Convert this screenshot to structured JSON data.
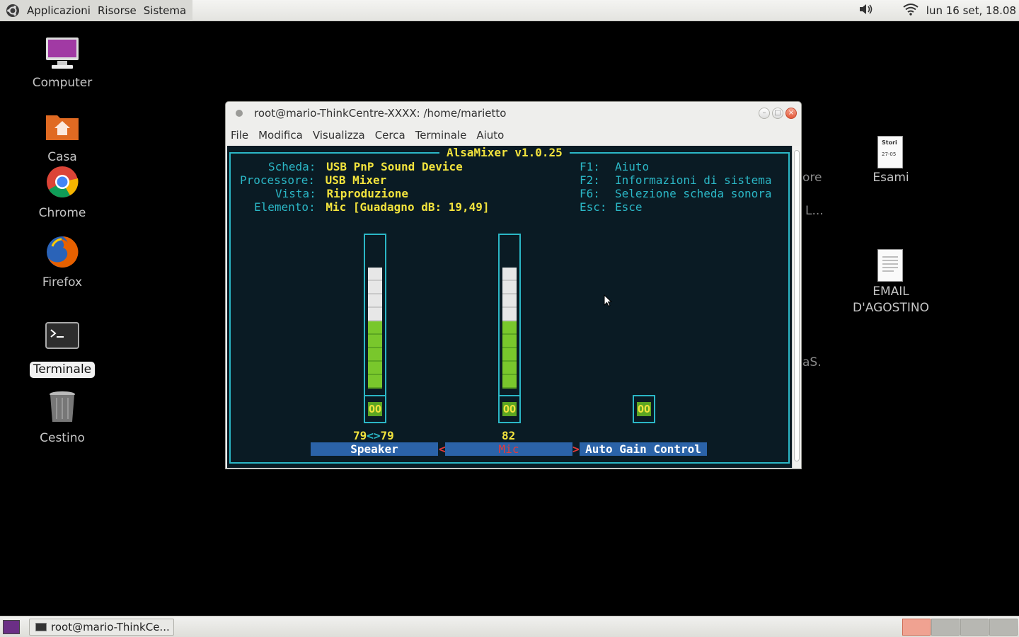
{
  "top_panel": {
    "menus": [
      "Applicazioni",
      "Risorse",
      "Sistema"
    ],
    "clock": "lun 16 set, 18.08"
  },
  "desktop": {
    "icons": [
      {
        "label": "Computer"
      },
      {
        "label": "Casa"
      },
      {
        "label": "Chrome"
      },
      {
        "label": "Firefox"
      },
      {
        "label": "Terminale"
      },
      {
        "label": "Cestino"
      }
    ],
    "right_icons": [
      {
        "label": "Esami",
        "thumb_text_1": "Stori",
        "thumb_text_2": "27-05"
      },
      {
        "label_line1": "EMAIL",
        "label_line2": "D'AGOSTINO"
      }
    ],
    "partial_labels": [
      "ore",
      "L...",
      "aS."
    ]
  },
  "window": {
    "title": "root@mario-ThinkCentre-XXXX: /home/marietto",
    "menus": [
      "File",
      "Modifica",
      "Visualizza",
      "Cerca",
      "Terminale",
      "Aiuto"
    ]
  },
  "alsamixer": {
    "title": "AlsaMixer v1.0.25",
    "info": [
      {
        "label": "Scheda:",
        "value": "USB PnP Sound Device"
      },
      {
        "label": "Processore:",
        "value": "USB Mixer"
      },
      {
        "label": "Vista:",
        "value": "Riproduzione"
      },
      {
        "label": "Elemento:",
        "value": "Mic [Guadagno dB: 19,49]"
      }
    ],
    "keys": [
      {
        "key": "F1:",
        "desc": "Aiuto"
      },
      {
        "key": "F2:",
        "desc": "Informazioni di sistema"
      },
      {
        "key": "F6:",
        "desc": "Selezione scheda sonora"
      },
      {
        "key": "Esc:",
        "desc": "Esce"
      }
    ],
    "controls": [
      {
        "name": "Speaker",
        "volume_left": "79",
        "arrows": "<>",
        "volume_right": "79",
        "mute": "OO",
        "level": 0.79
      },
      {
        "name": "Mic",
        "volume": "82",
        "mute": "OO",
        "level": 0.82
      },
      {
        "name": "Auto Gain Control",
        "mute": "OO"
      }
    ],
    "markers": [
      "<",
      ">"
    ]
  },
  "taskbar": {
    "task_label": "root@mario-ThinkCe..."
  }
}
